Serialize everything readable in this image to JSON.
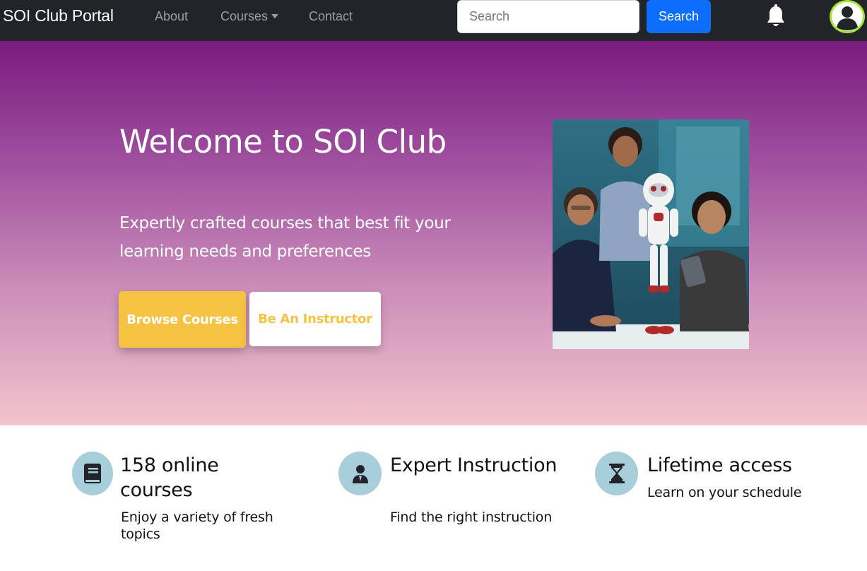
{
  "navbar": {
    "brand": "SOI Club Portal",
    "links": {
      "about": "About",
      "courses": "Courses",
      "contact": "Contact"
    },
    "search": {
      "placeholder": "Search",
      "button_label": "Search"
    },
    "icons": [
      "bell-icon",
      "user-avatar-icon"
    ]
  },
  "hero": {
    "title": "Welcome to SOI Club",
    "subtitle": "Expertly crafted courses that best fit your learning needs and preferences",
    "buttons": {
      "browse": "Browse Courses",
      "instructor": "Be An Instructor"
    },
    "image_icon": "students-with-robot-photo"
  },
  "features": [
    {
      "icon": "book-icon",
      "title": "158 online courses",
      "description": "Enjoy a variety of fresh topics"
    },
    {
      "icon": "instructor-icon",
      "title": "Expert Instruction",
      "description": "Find the right instruction"
    },
    {
      "icon": "hourglass-icon",
      "title": "Lifetime access",
      "description": "Learn on your schedule"
    }
  ],
  "colors": {
    "navbar_bg": "#212529",
    "primary_blue": "#0d6efd",
    "accent_yellow": "#f5c242",
    "hero_gradient_top": "#7a1b80",
    "hero_gradient_bottom": "#f4c3cc",
    "feature_icon_bg": "#a8cddb",
    "avatar_border": "#a3e635"
  }
}
